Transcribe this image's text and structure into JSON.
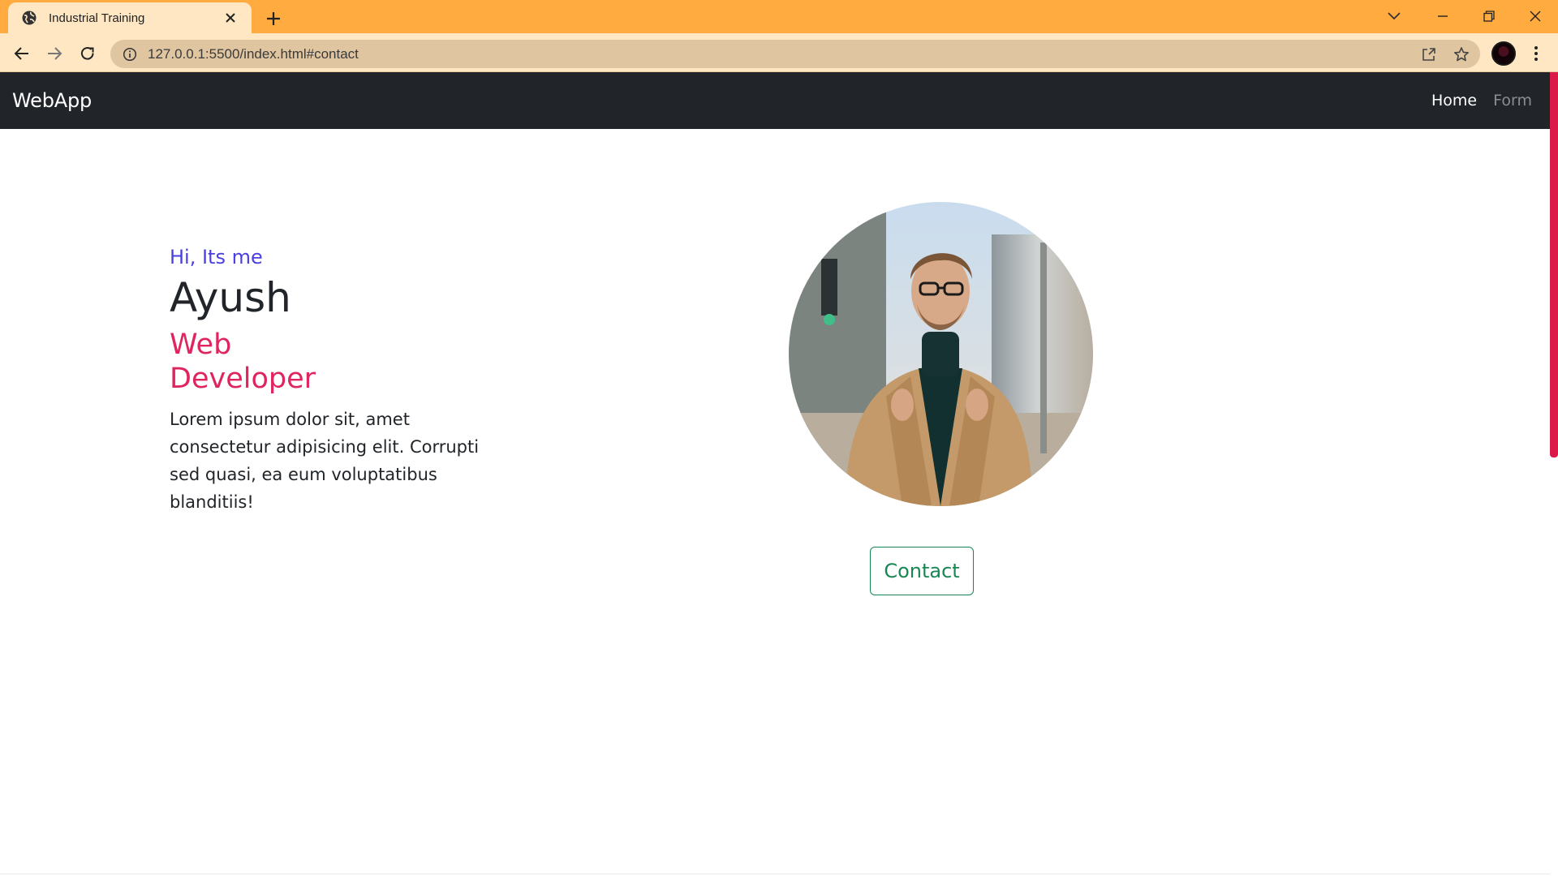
{
  "browser": {
    "tab": {
      "title": "Industrial Training"
    },
    "url": "127.0.0.1:5500/index.html#contact",
    "colors": {
      "tabstrip": "#ffab40",
      "toolbar": "#ffe7c3",
      "omnibox": "#e0c5a1"
    },
    "icons": {
      "favicon": "globe-icon",
      "tab_close": "close-icon",
      "new_tab": "plus-icon",
      "back": "back-arrow-icon",
      "forward": "forward-arrow-icon",
      "reload": "reload-icon",
      "info": "info-icon",
      "share": "share-icon",
      "bookmark": "star-icon",
      "menu": "kebab-menu-icon",
      "tab_search": "chevron-down-icon",
      "minimize": "minimize-icon",
      "maximize": "restore-icon",
      "close_window": "close-icon"
    }
  },
  "navbar": {
    "brand": "WebApp",
    "links": [
      {
        "label": "Home",
        "active": true
      },
      {
        "label": "Form",
        "active": false
      }
    ]
  },
  "hero": {
    "greeting": "Hi, Its me",
    "name": "Ayush",
    "role": "Web Developer",
    "description": "Lorem ipsum dolor sit, amet consectetur adipisicing elit. Corrupti sed quasi, ea eum voluptatibus blanditiis!",
    "contact_label": "Contact",
    "colors": {
      "greeting": "#4a3fe0",
      "role": "#e0245e",
      "contact": "#198754",
      "navbar": "#212529"
    }
  }
}
